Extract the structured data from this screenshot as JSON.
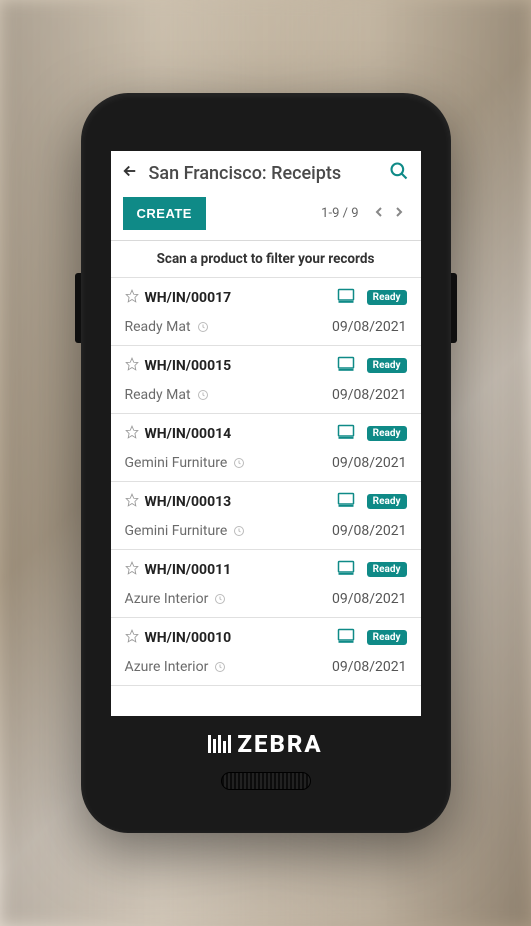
{
  "header": {
    "title": "San Francisco: Receipts"
  },
  "toolbar": {
    "create_label": "CREATE",
    "pager": "1-9 / 9"
  },
  "scan_banner": "Scan a product to filter your records",
  "records": [
    {
      "ref": "WH/IN/00017",
      "partner": "Ready Mat",
      "date": "09/08/2021",
      "status": "Ready"
    },
    {
      "ref": "WH/IN/00015",
      "partner": "Ready Mat",
      "date": "09/08/2021",
      "status": "Ready"
    },
    {
      "ref": "WH/IN/00014",
      "partner": "Gemini Furniture",
      "date": "09/08/2021",
      "status": "Ready"
    },
    {
      "ref": "WH/IN/00013",
      "partner": "Gemini Furniture",
      "date": "09/08/2021",
      "status": "Ready"
    },
    {
      "ref": "WH/IN/00011",
      "partner": "Azure Interior",
      "date": "09/08/2021",
      "status": "Ready"
    },
    {
      "ref": "WH/IN/00010",
      "partner": "Azure Interior",
      "date": "09/08/2021",
      "status": "Ready"
    }
  ],
  "brand": "ZEBRA"
}
